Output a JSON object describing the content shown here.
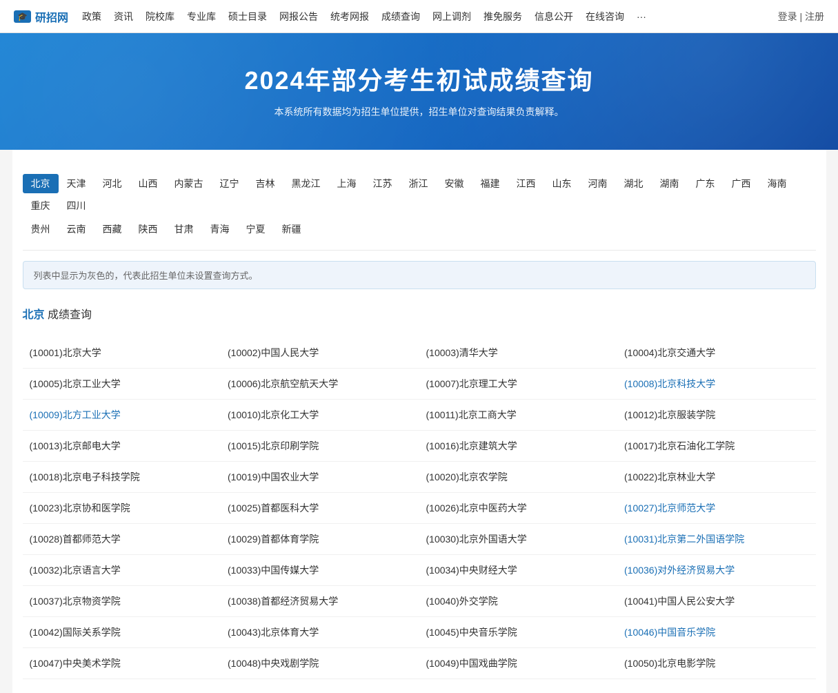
{
  "navbar": {
    "logo_icon": "🎓",
    "logo_text": "研招网",
    "nav_items": [
      "政策",
      "资讯",
      "院校库",
      "专业库",
      "硕士目录",
      "网报公告",
      "统考网报",
      "成绩查询",
      "网上调剂",
      "推免服务",
      "信息公开",
      "在线咨询",
      "···"
    ],
    "login": "登录",
    "register": "注册",
    "separator": "|"
  },
  "hero": {
    "title": "2024年部分考生初试成绩查询",
    "subtitle": "本系统所有数据均为招生单位提供，招生单位对查询结果负责解释。"
  },
  "provinces_row1": [
    "北京",
    "天津",
    "河北",
    "山西",
    "内蒙古",
    "辽宁",
    "吉林",
    "黑龙江",
    "上海",
    "江苏",
    "浙江",
    "安徽",
    "福建",
    "江西",
    "山东",
    "河南",
    "湖北",
    "湖南",
    "广东",
    "广西",
    "海南",
    "重庆",
    "四川"
  ],
  "provinces_row2": [
    "贵州",
    "云南",
    "西藏",
    "陕西",
    "甘肃",
    "青海",
    "宁夏",
    "新疆"
  ],
  "active_province": "北京",
  "notice": "列表中显示为灰色的，代表此招生单位未设置查询方式。",
  "section": {
    "city": "北京",
    "suffix": " 成绩查询"
  },
  "universities": [
    [
      {
        "id": "10001",
        "name": "北京大学",
        "link": false
      },
      {
        "id": "10002",
        "name": "中国人民大学",
        "link": false
      },
      {
        "id": "10003",
        "name": "清华大学",
        "link": false
      },
      {
        "id": "10004",
        "name": "北京交通大学",
        "link": false
      }
    ],
    [
      {
        "id": "10005",
        "name": "北京工业大学",
        "link": false
      },
      {
        "id": "10006",
        "name": "北京航空航天大学",
        "link": false
      },
      {
        "id": "10007",
        "name": "北京理工大学",
        "link": false
      },
      {
        "id": "10008",
        "name": "北京科技大学",
        "link": true
      }
    ],
    [
      {
        "id": "10009",
        "name": "北方工业大学",
        "link": true
      },
      {
        "id": "10010",
        "name": "北京化工大学",
        "link": false
      },
      {
        "id": "10011",
        "name": "北京工商大学",
        "link": false
      },
      {
        "id": "10012",
        "name": "北京服装学院",
        "link": false
      }
    ],
    [
      {
        "id": "10013",
        "name": "北京邮电大学",
        "link": false
      },
      {
        "id": "10015",
        "name": "北京印刷学院",
        "link": false
      },
      {
        "id": "10016",
        "name": "北京建筑大学",
        "link": false
      },
      {
        "id": "10017",
        "name": "北京石油化工学院",
        "link": false
      }
    ],
    [
      {
        "id": "10018",
        "name": "北京电子科技学院",
        "link": false
      },
      {
        "id": "10019",
        "name": "中国农业大学",
        "link": false
      },
      {
        "id": "10020",
        "name": "北京农学院",
        "link": false
      },
      {
        "id": "10022",
        "name": "北京林业大学",
        "link": false
      }
    ],
    [
      {
        "id": "10023",
        "name": "北京协和医学院",
        "link": false
      },
      {
        "id": "10025",
        "name": "首都医科大学",
        "link": false
      },
      {
        "id": "10026",
        "name": "北京中医药大学",
        "link": false
      },
      {
        "id": "10027",
        "name": "北京师范大学",
        "link": true
      }
    ],
    [
      {
        "id": "10028",
        "name": "首都师范大学",
        "link": false
      },
      {
        "id": "10029",
        "name": "首都体育学院",
        "link": false
      },
      {
        "id": "10030",
        "name": "北京外国语大学",
        "link": false
      },
      {
        "id": "10031",
        "name": "北京第二外国语学院",
        "link": true
      }
    ],
    [
      {
        "id": "10032",
        "name": "北京语言大学",
        "link": false
      },
      {
        "id": "10033",
        "name": "中国传媒大学",
        "link": false
      },
      {
        "id": "10034",
        "name": "中央财经大学",
        "link": false
      },
      {
        "id": "10036",
        "name": "对外经济贸易大学",
        "link": true
      }
    ],
    [
      {
        "id": "10037",
        "name": "北京物资学院",
        "link": false
      },
      {
        "id": "10038",
        "name": "首都经济贸易大学",
        "link": false
      },
      {
        "id": "10040",
        "name": "外交学院",
        "link": false
      },
      {
        "id": "10041",
        "name": "中国人民公安大学",
        "link": false
      }
    ],
    [
      {
        "id": "10042",
        "name": "国际关系学院",
        "link": false
      },
      {
        "id": "10043",
        "name": "北京体育大学",
        "link": false
      },
      {
        "id": "10045",
        "name": "中央音乐学院",
        "link": false
      },
      {
        "id": "10046",
        "name": "中国音乐学院",
        "link": true
      }
    ],
    [
      {
        "id": "10047",
        "name": "中央美术学院",
        "link": false
      },
      {
        "id": "10048",
        "name": "中央戏剧学院",
        "link": false
      },
      {
        "id": "10049",
        "name": "中国戏曲学院",
        "link": false
      },
      {
        "id": "10050",
        "name": "北京电影学院",
        "link": false
      }
    ]
  ]
}
